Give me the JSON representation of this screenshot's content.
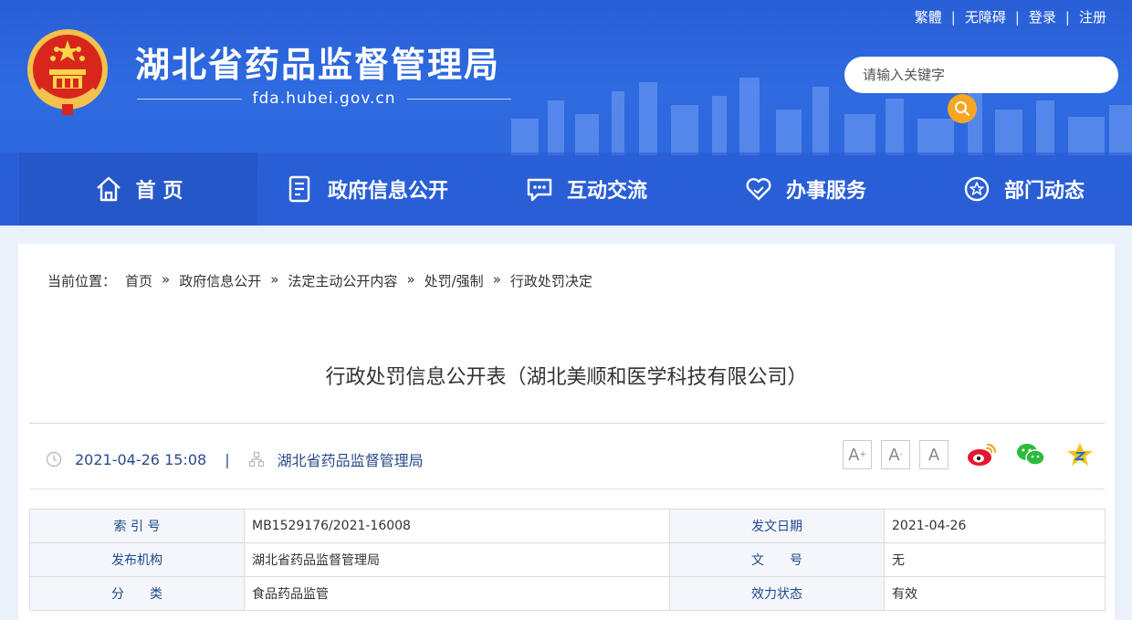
{
  "header": {
    "title": "湖北省药品监督管理局",
    "domain": "fda.hubei.gov.cn",
    "top_links": [
      "繁體",
      "无障碍",
      "登录",
      "注册"
    ],
    "search": {
      "placeholder": "请输入关键字"
    }
  },
  "nav": {
    "items": [
      {
        "label": "首 页",
        "icon": "home-icon"
      },
      {
        "label": "政府信息公开",
        "icon": "document-icon"
      },
      {
        "label": "互动交流",
        "icon": "chat-icon"
      },
      {
        "label": "办事服务",
        "icon": "heart-hands-icon"
      },
      {
        "label": "部门动态",
        "icon": "star-circle-icon"
      }
    ]
  },
  "breadcrumb": {
    "prefix": "当前位置：",
    "items": [
      "首页",
      "政府信息公开",
      "法定主动公开内容",
      "处罚/强制",
      "行政处罚决定"
    ]
  },
  "article": {
    "title": "行政处罚信息公开表（湖北美顺和医学科技有限公司）",
    "datetime": "2021-04-26 15:08",
    "source": "湖北省药品监督管理局"
  },
  "tools": {
    "font_larger": "A",
    "font_smaller": "A",
    "font_default": "A"
  },
  "info_table": {
    "rows": [
      {
        "k1": "索 引 号",
        "v1": "MB1529176/2021-16008",
        "k2": "发文日期",
        "v2": "2021-04-26"
      },
      {
        "k1": "发布机构",
        "v1": "湖北省药品监督管理局",
        "k2": "文　　号",
        "v2": "无"
      },
      {
        "k1": "分　　类",
        "v1": "食品药品监管",
        "k2": "效力状态",
        "v2": "有效"
      }
    ]
  },
  "colors": {
    "header_blue": "#2e6ae0",
    "nav_active": "#2557c9",
    "search_button": "#f5a623",
    "label_text": "#1f4a8c"
  }
}
